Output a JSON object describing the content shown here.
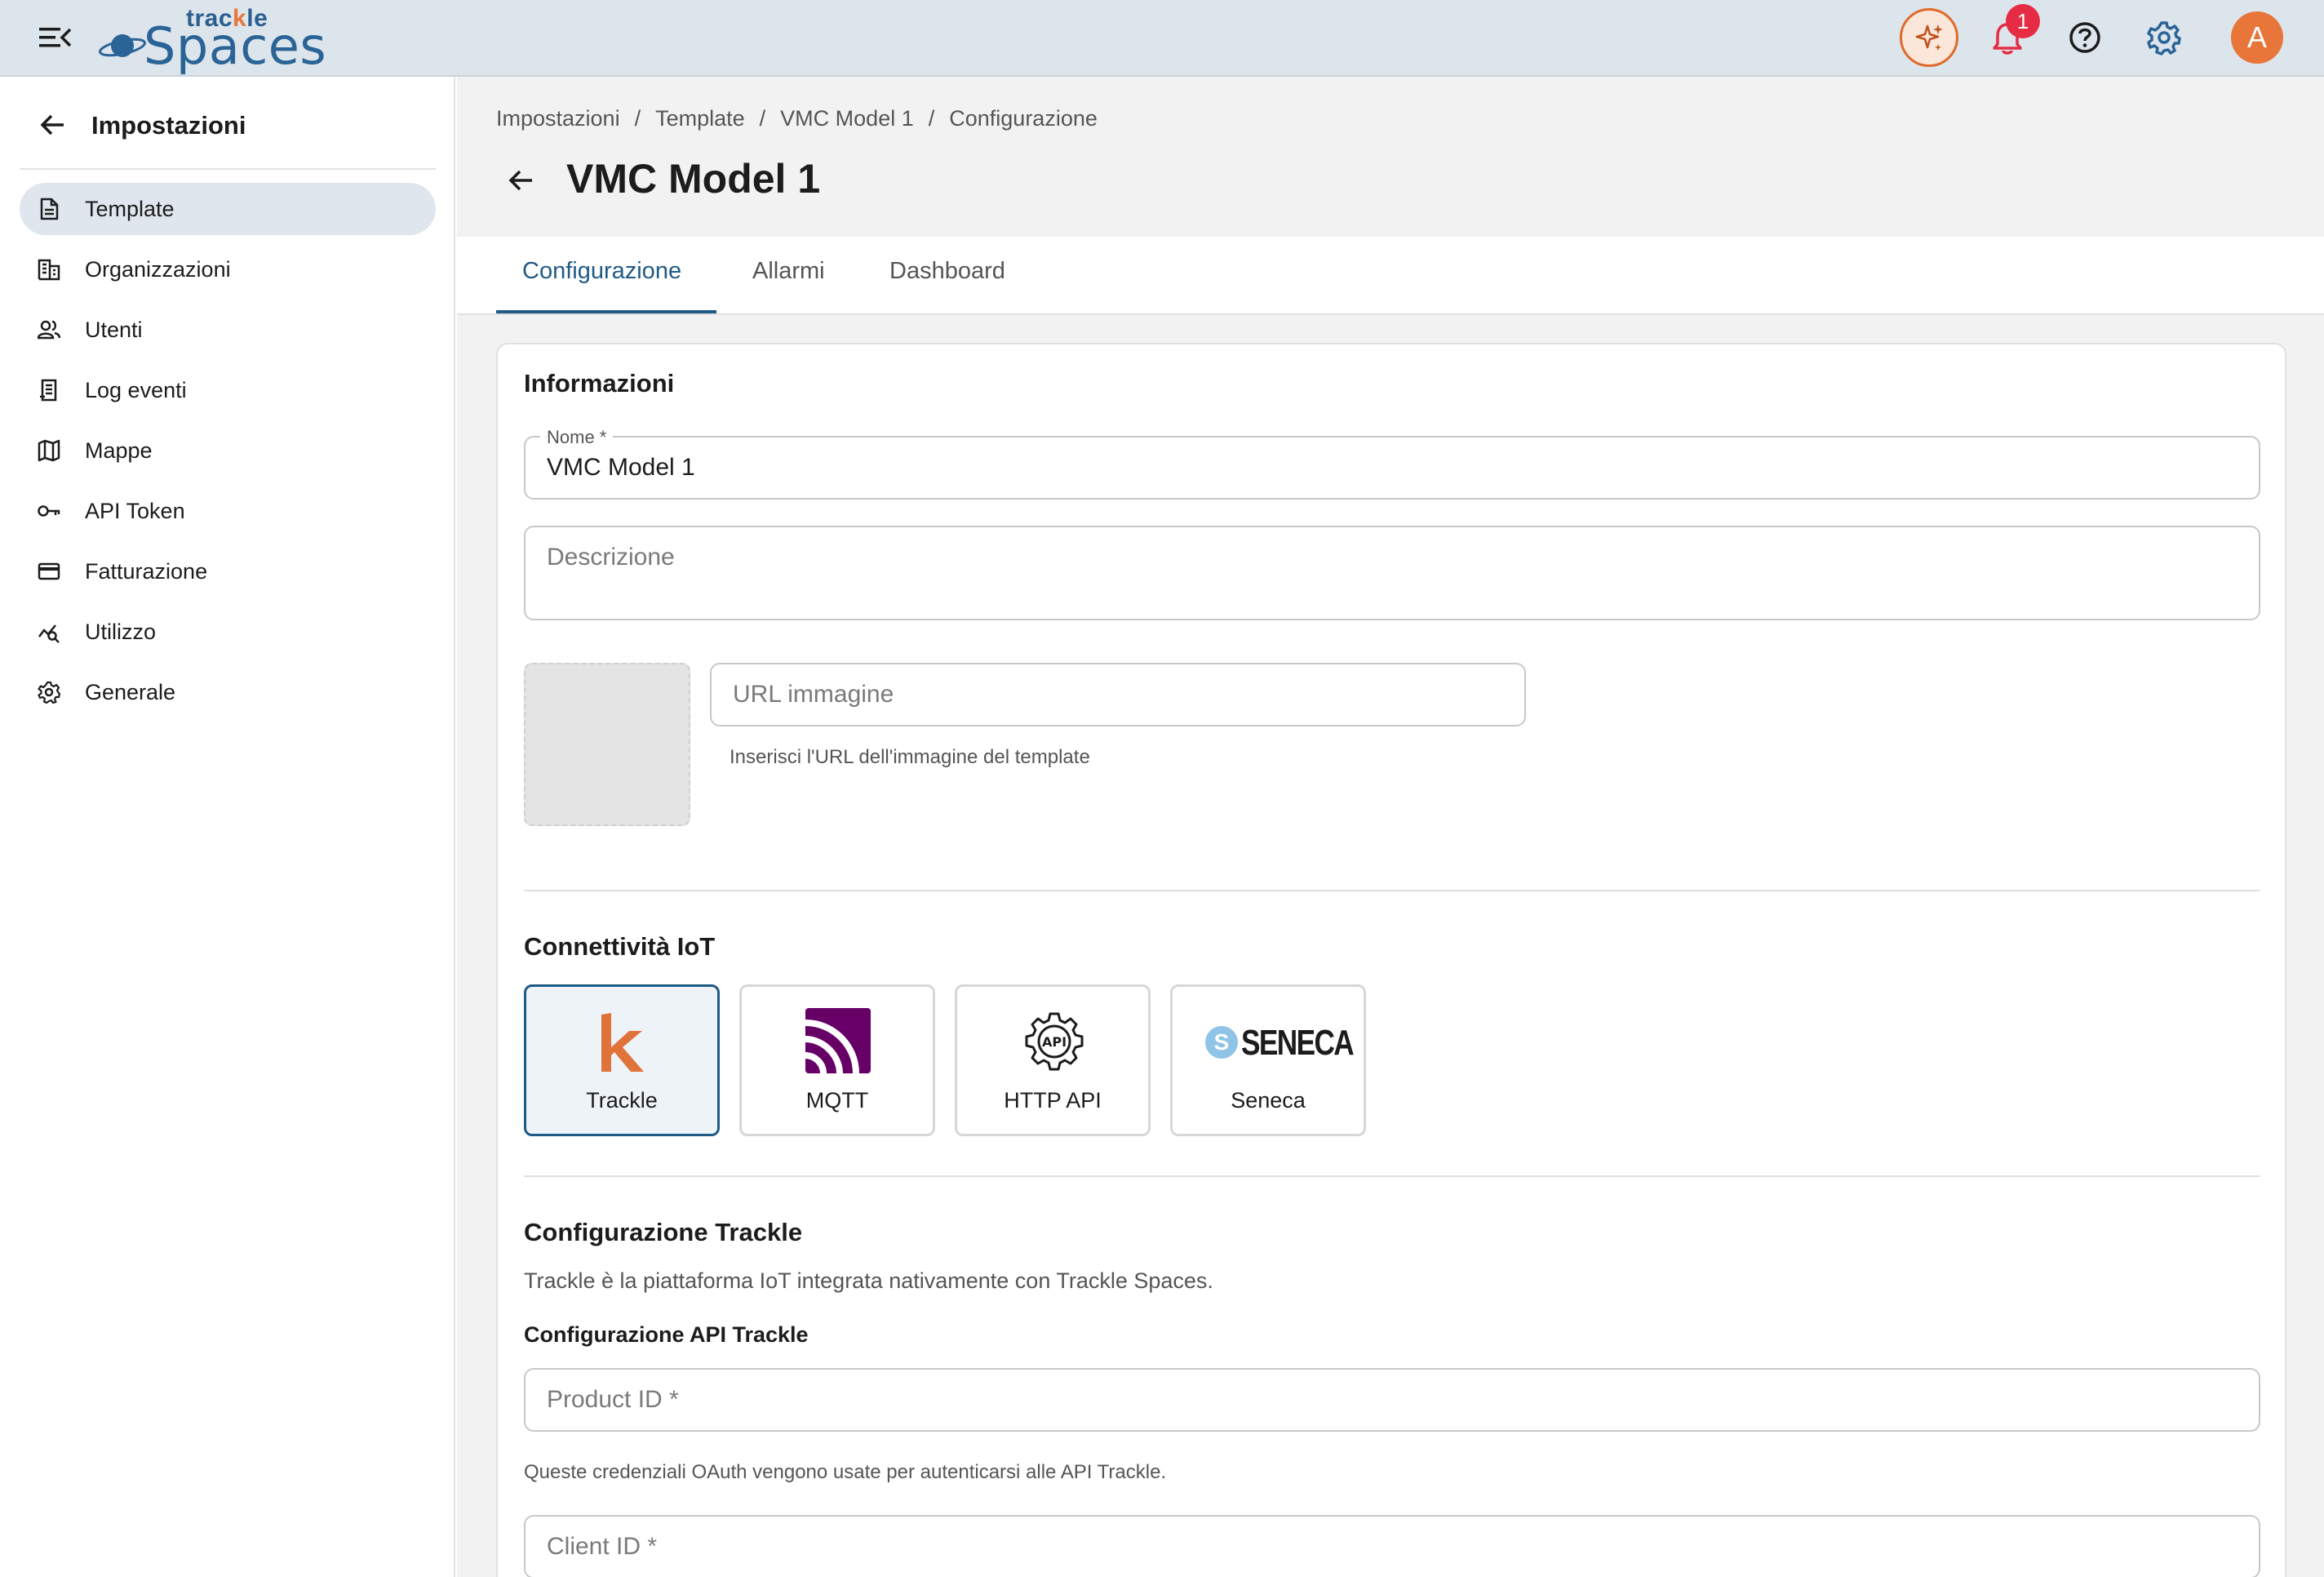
{
  "topbar": {
    "logo_small": "trackle",
    "logo_large": "Spaces",
    "notification_count": "1",
    "avatar_initial": "A",
    "colors": {
      "accent": "#e8753a",
      "brand": "#2a6497",
      "badge": "#e52c44"
    }
  },
  "sidebar": {
    "title": "Impostazioni",
    "items": [
      {
        "label": "Template",
        "icon": "document-icon",
        "active": true
      },
      {
        "label": "Organizzazioni",
        "icon": "building-icon"
      },
      {
        "label": "Utenti",
        "icon": "users-icon"
      },
      {
        "label": "Log eventi",
        "icon": "log-icon"
      },
      {
        "label": "Mappe",
        "icon": "map-icon"
      },
      {
        "label": "API Token",
        "icon": "key-icon"
      },
      {
        "label": "Fatturazione",
        "icon": "credit-card-icon"
      },
      {
        "label": "Utilizzo",
        "icon": "usage-icon"
      },
      {
        "label": "Generale",
        "icon": "gear-icon"
      }
    ]
  },
  "breadcrumb": [
    "Impostazioni",
    "Template",
    "VMC Model 1",
    "Configurazione"
  ],
  "page": {
    "title": "VMC Model 1"
  },
  "tabs": [
    "Configurazione",
    "Allarmi",
    "Dashboard"
  ],
  "form": {
    "info_title": "Informazioni",
    "name_label": "Nome *",
    "name_value": "VMC Model 1",
    "description_placeholder": "Descrizione",
    "image_url_placeholder": "URL immagine",
    "image_url_helper": "Inserisci l'URL dell'immagine del template",
    "iot_title": "Connettività IoT",
    "connectivity": [
      {
        "label": "Trackle",
        "selected": true
      },
      {
        "label": "MQTT"
      },
      {
        "label": "HTTP API"
      },
      {
        "label": "Seneca",
        "logo_text": "SENECA"
      }
    ],
    "trackle_config_title": "Configurazione Trackle",
    "trackle_config_desc": "Trackle è la piattaforma IoT integrata nativamente con Trackle Spaces.",
    "api_config_title": "Configurazione API Trackle",
    "product_id_placeholder": "Product ID *",
    "oauth_helper": "Queste credenziali OAuth vengono usate per autenticarsi alle API Trackle.",
    "client_id_placeholder": "Client ID *"
  }
}
